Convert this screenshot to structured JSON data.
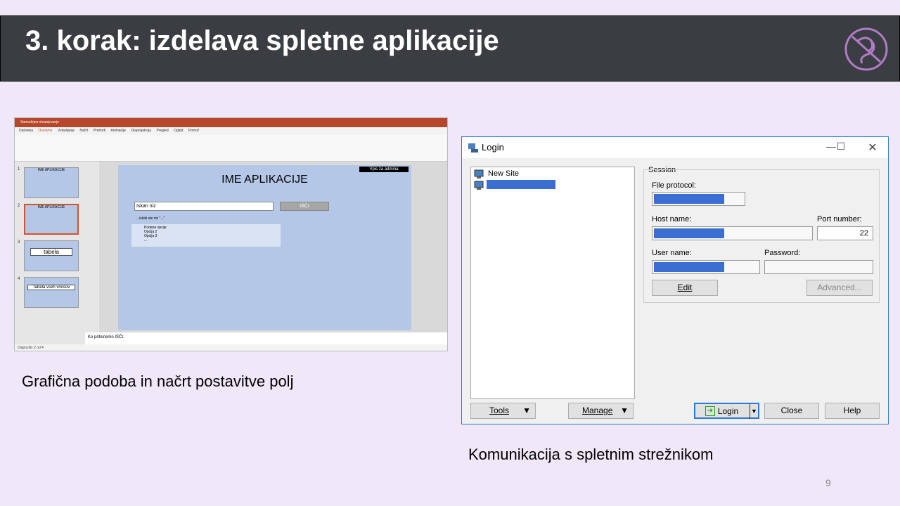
{
  "slide": {
    "title": "3. korak: izdelava spletne aplikacije",
    "caption_left": "Grafična podoba in načrt postavitve polj",
    "caption_right": "Komunikacija s spletnim strežnikom",
    "page_number": "9"
  },
  "ppt": {
    "title_bar": "Samodejno shranjevanje",
    "menu": [
      "Datoteka",
      "Osnovno",
      "Vstavljanje",
      "Načrt",
      "Prehodi",
      "Animacije",
      "Diaprojekcija",
      "Pregled",
      "Ogled",
      "Pomoč"
    ],
    "thumbs": [
      {
        "num": "1",
        "label": "IME APLIKACIJE"
      },
      {
        "num": "2",
        "label": "IME APLIKACIJE"
      },
      {
        "num": "3",
        "label": "tabela"
      },
      {
        "num": "4",
        "label": "Tabela vseh vnosov"
      }
    ],
    "slide_title": "IME APLIKACIJE",
    "admin_button": "Vpis za admina",
    "search_value": "Iskan niz",
    "search_button": "IŠČI",
    "results_heading": "...iskali ste niz \"...\"",
    "results": [
      "Podane opcije",
      "Opcija 2",
      "Opcija 3",
      "..."
    ],
    "notes": "Ko pritisnemo IŠČI.",
    "status": "Diapozitiv 2 od 4"
  },
  "login": {
    "title": "Login",
    "tree_item": "New Site",
    "session_label": "Session",
    "file_protocol_label": "File protocol:",
    "host_label": "Host name:",
    "port_label": "Port number:",
    "port_value": "22",
    "user_label": "User name:",
    "password_label": "Password:",
    "edit_button": "Edit",
    "advanced_button": "Advanced...",
    "tools_button": "Tools",
    "manage_button": "Manage",
    "login_button": "Login",
    "close_button": "Close",
    "help_button": "Help"
  }
}
